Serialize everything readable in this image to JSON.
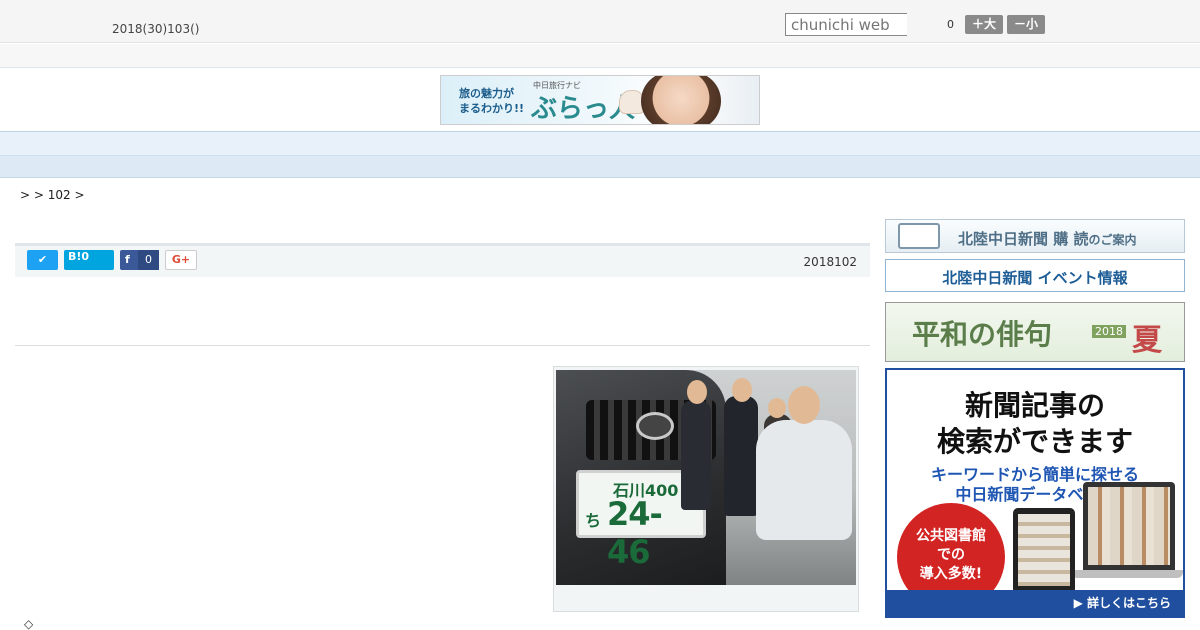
{
  "header": {
    "date": "2018(30)103()",
    "search_placeholder": "chunichi web",
    "count": "0",
    "font_up": "＋大",
    "font_down": "－小"
  },
  "banner": {
    "line1": "旅の魅力が",
    "line2": "まるわかり!!",
    "small": "中日旅行ナビ",
    "brand": "ぶらっ人"
  },
  "nav": {
    "items": [
      "",
      "",
      "",
      "",
      "",
      "",
      "",
      "",
      ""
    ]
  },
  "breadcrumb": "> > 102 >",
  "article": {
    "share_tw": "",
    "share_hb": "B!0",
    "share_fb_count": "0",
    "share_gp": "G+",
    "date": "2018102",
    "photo": {
      "plate_region": "石川400",
      "plate_kana": "ち",
      "plate_number": "24-46"
    }
  },
  "sidebar": {
    "subscribe_main": "北陸中日新聞 購 読",
    "subscribe_small": "のご案内",
    "events": "北陸中日新聞 イベント情報",
    "haiku": "平和の俳句",
    "haiku_year": "2018",
    "haiku_season": "夏",
    "db_title1": "新聞記事の",
    "db_title2": "検索ができます",
    "db_sub1": "キーワードから簡単に探せる",
    "db_sub2": "中日新聞データベース",
    "db_circle1": "公共図書館",
    "db_circle2": "での",
    "db_circle3": "導入多数!",
    "db_more": "▶ 詳しくはこちら"
  },
  "footer_mark": "◇"
}
